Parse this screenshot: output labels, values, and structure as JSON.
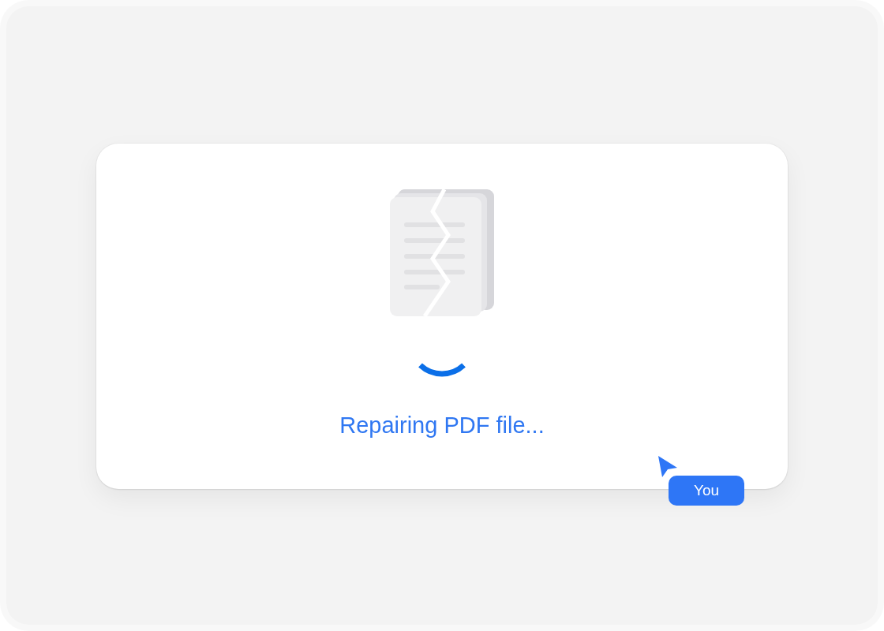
{
  "status": {
    "message": "Repairing PDF file..."
  },
  "cursor": {
    "label": "You"
  }
}
